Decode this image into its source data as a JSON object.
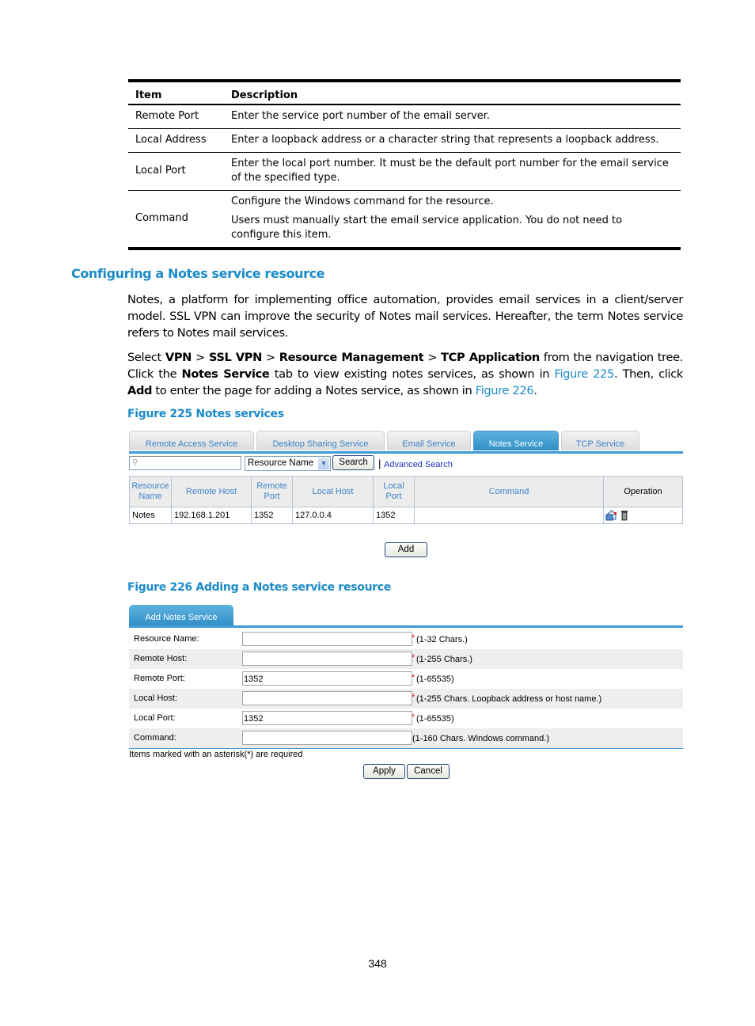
{
  "doc_table": {
    "headers": [
      "Item",
      "Description"
    ],
    "rows": [
      {
        "item": "Remote Port",
        "desc": [
          "Enter the service port number of the email server."
        ]
      },
      {
        "item": "Local Address",
        "desc": [
          "Enter a loopback address or a character string that represents a loopback address."
        ]
      },
      {
        "item": "Local Port",
        "desc": [
          "Enter the local port number. It must be the default port number for the email service of the specified type."
        ]
      },
      {
        "item": "Command",
        "desc": [
          "Configure the Windows command for the resource.",
          "Users must manually start the email service application. You do not need to configure this item."
        ]
      }
    ]
  },
  "section": {
    "title": "Configuring a Notes service resource",
    "para1": "Notes, a platform for implementing office automation, provides email services in a client/server model. SSL VPN can improve the security of Notes mail services. Hereafter, the term Notes service refers to Notes mail services.",
    "para2": {
      "t1": "Select ",
      "b1": "VPN",
      "t2": " > ",
      "b2": "SSL VPN",
      "t3": " > ",
      "b3": "Resource Management",
      "t4": " > ",
      "b4": "TCP Application",
      "t5": " from the navigation tree. Click the ",
      "b5": "Notes Service",
      "t6": " tab to view existing notes services, as shown in ",
      "l1": "Figure 225",
      "t7": ". Then, click ",
      "b6": "Add",
      "t8": " to enter the page for adding a Notes service, as shown in ",
      "l2": "Figure 226",
      "t9": "."
    }
  },
  "fig225": {
    "caption": "Figure 225 Notes services",
    "tabs": [
      "Remote Access Service",
      "Desktop Sharing Service",
      "Email Service",
      "Notes Service",
      "TCP Service"
    ],
    "active_tab": "Notes Service",
    "search": {
      "value": "",
      "select_value": "Resource Name",
      "search_label": "Search",
      "advanced_label": "Advanced Search",
      "separator": "|"
    },
    "columns": [
      "Resource\nName",
      "Remote Host",
      "Remote\nPort",
      "Local Host",
      "Local\nPort",
      "Command",
      "Operation"
    ],
    "rows": [
      {
        "name": "Notes",
        "remote_host": "192.168.1.201",
        "remote_port": "1352",
        "local_host": "127.0.0.4",
        "local_port": "1352",
        "command": ""
      }
    ],
    "add_label": "Add"
  },
  "fig226": {
    "caption": "Figure 226 Adding a Notes service resource",
    "tab": "Add Notes Service",
    "fields": [
      {
        "label": "Resource Name:",
        "value": "",
        "required": true,
        "hint": "(1-32 Chars.)"
      },
      {
        "label": "Remote Host:",
        "value": "",
        "required": true,
        "hint": "(1-255 Chars.)"
      },
      {
        "label": "Remote Port:",
        "value": "1352",
        "required": true,
        "hint": "(1-65535)"
      },
      {
        "label": "Local Host:",
        "value": "",
        "required": true,
        "hint": "(1-255 Chars. Loopback address or host name.)"
      },
      {
        "label": "Local Port:",
        "value": "1352",
        "required": true,
        "hint": "(1-65535)"
      },
      {
        "label": "Command:",
        "value": "",
        "required": false,
        "hint": "(1-160 Chars. Windows command.)"
      }
    ],
    "note": "Items marked with an asterisk(*) are required",
    "apply_label": "Apply",
    "cancel_label": "Cancel",
    "asterisk": "*"
  },
  "page_number": "348"
}
